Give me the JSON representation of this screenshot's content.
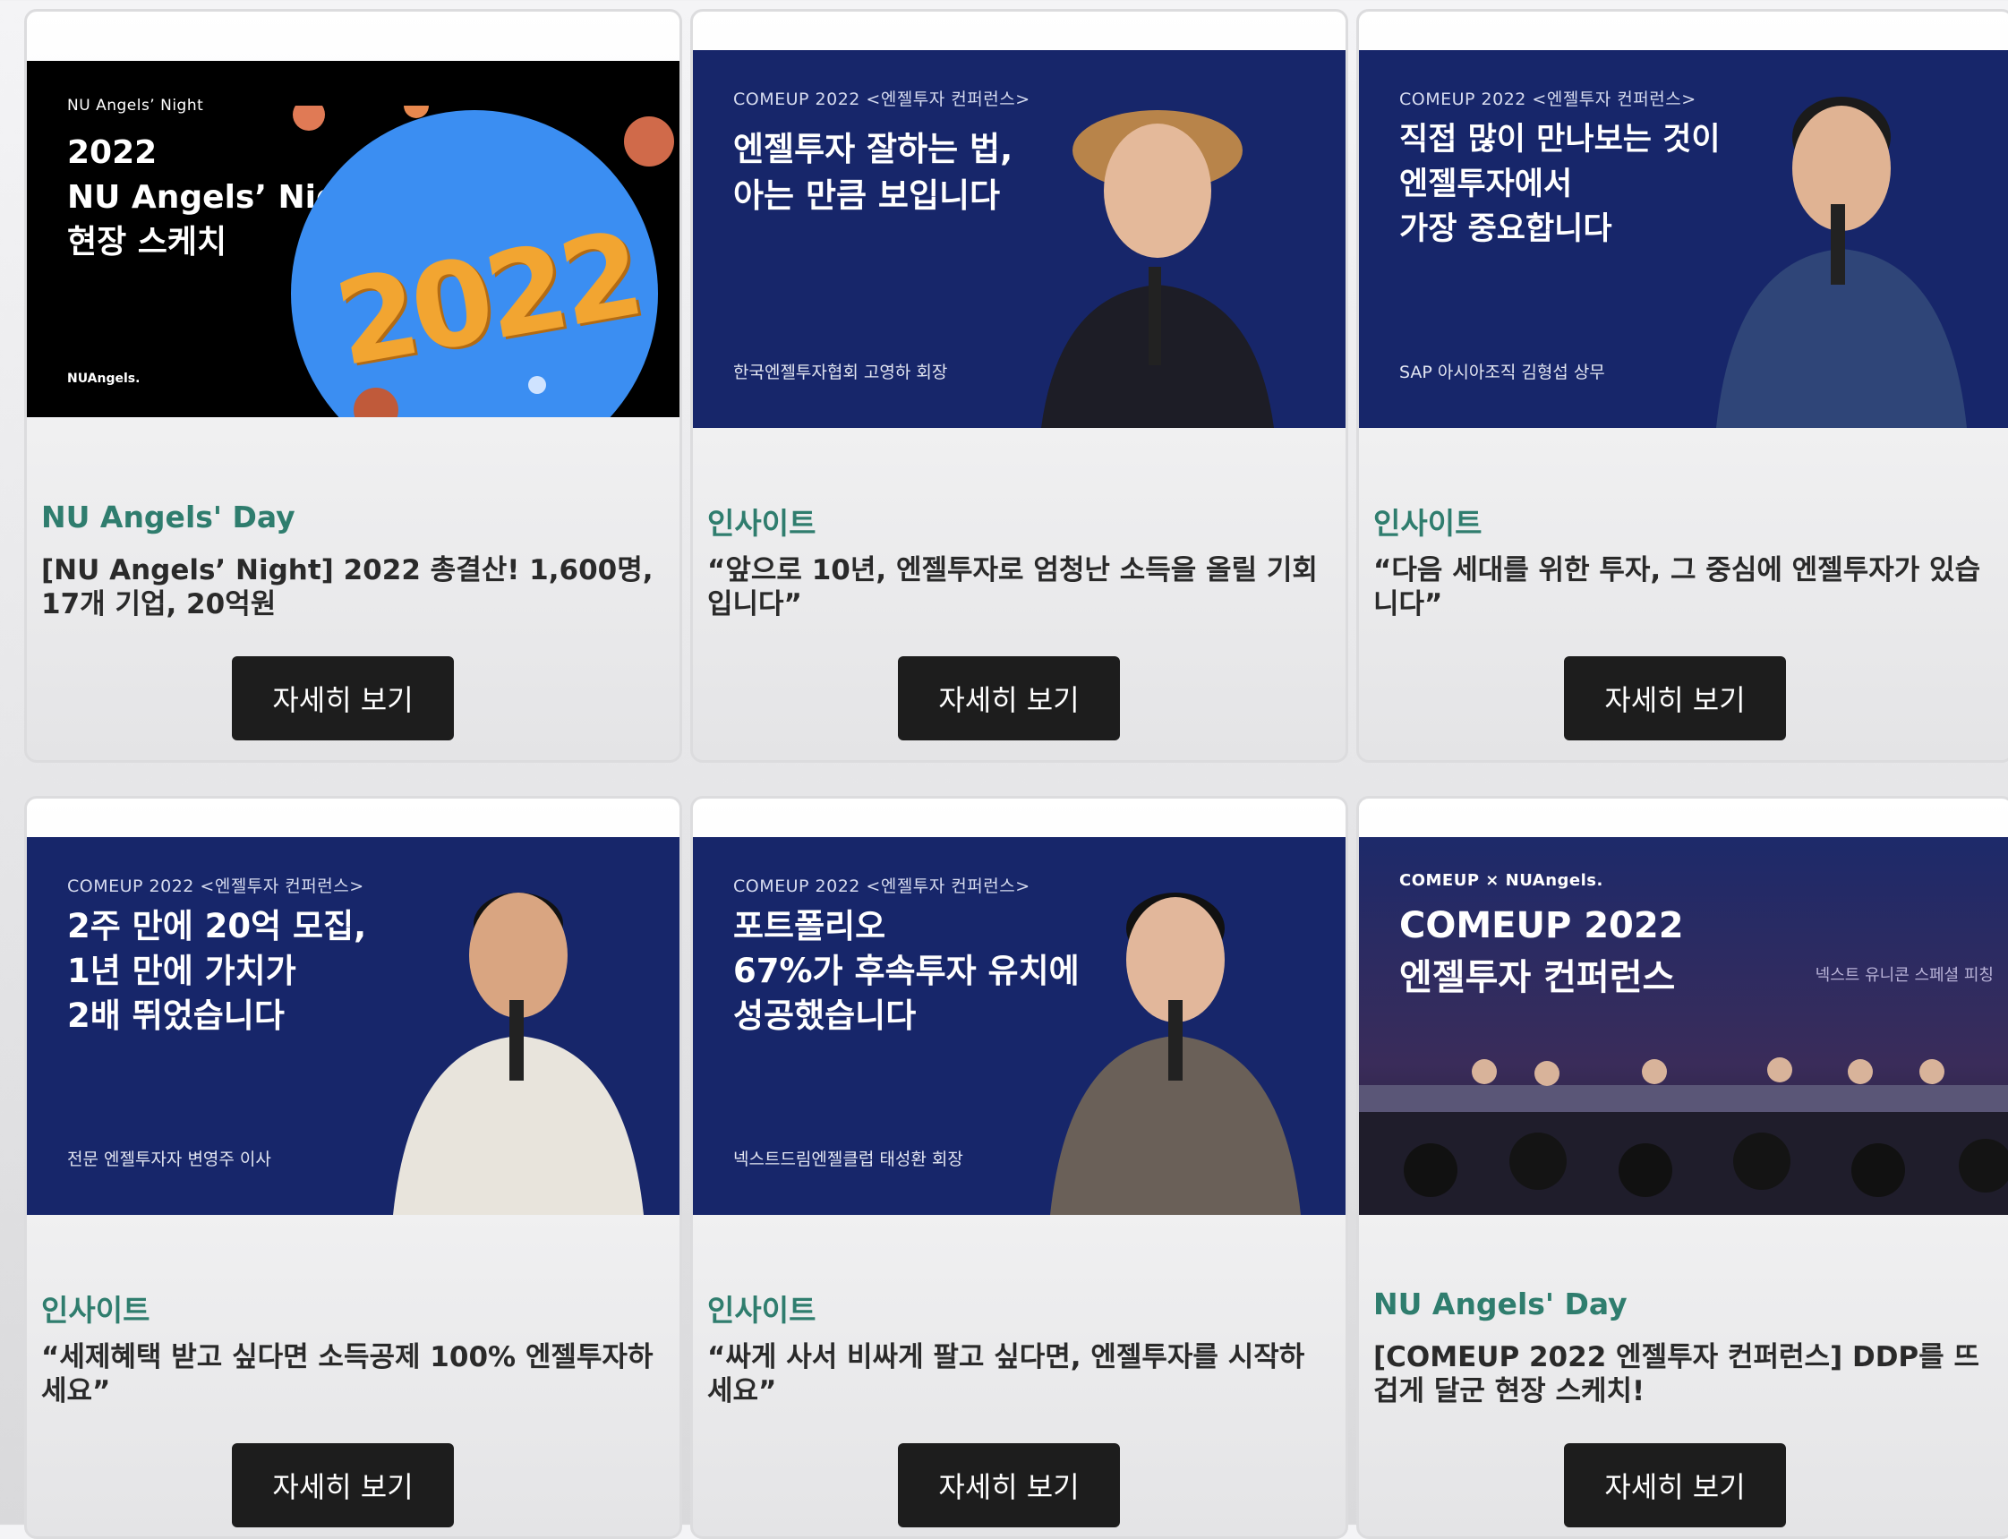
{
  "detail_label": "자세히 보기",
  "cards": [
    {
      "category": "NU Angels' Day",
      "title": "[NU Angels’ Night] 2022 총결산! 1,600명, 17개 기업, 20억원",
      "thumb": {
        "kicker": "NU Angels’ Night",
        "headline": "2022\nNU Angels’ Night\n현장 스케치",
        "big_number": "2022",
        "logo": "NUAngels."
      }
    },
    {
      "category": "인사이트",
      "title": "“앞으로 10년, 엔젤투자로 엄청난 소득을 올릴 기회입니다”",
      "thumb": {
        "kicker": "COMEUP 2022 <엔젤투자 컨퍼런스>",
        "headline": "엔젤투자 잘하는 법,\n아는 만큼 보입니다",
        "caption": "한국엔젤투자협회 고영하 회장"
      }
    },
    {
      "category": "인사이트",
      "title": "“다음 세대를 위한 투자, 그 중심에 엔젤투자가 있습니다”",
      "thumb": {
        "kicker": "COMEUP 2022 <엔젤투자 컨퍼런스>",
        "headline": "직접 많이 만나보는 것이\n엔젤투자에서\n가장 중요합니다",
        "caption": "SAP 아시아조직 김형섭 상무"
      }
    },
    {
      "category": "인사이트",
      "title": "“세제혜택 받고 싶다면 소득공제 100% 엔젤투자하세요”",
      "thumb": {
        "kicker": "COMEUP 2022 <엔젤투자 컨퍼런스>",
        "headline": "2주 만에 20억 모집,\n1년 만에 가치가\n2배 뛰었습니다",
        "caption": "전문 엔젤투자자 변영주 이사"
      }
    },
    {
      "category": "인사이트",
      "title": "“싸게 사서 비싸게 팔고 싶다면, 엔젤투자를 시작하세요”",
      "thumb": {
        "kicker": "COMEUP 2022 <엔젤투자 컨퍼런스>",
        "headline": "포트폴리오\n67%가 후속투자 유치에\n성공했습니다",
        "caption": "넥스트드림엔젤클럽 태성환 회장"
      }
    },
    {
      "category": "NU Angels' Day",
      "title": "[COMEUP 2022 엔젤투자 컨퍼런스] DDP를 뜨겁게 달군 현장 스케치!",
      "thumb": {
        "kicker": "COMEUP × NUAngels.",
        "headline": "COMEUP 2022\n엔젤투자 컨퍼런스",
        "caption": "넥스트 유니콘 스페셜 피칭"
      }
    }
  ]
}
